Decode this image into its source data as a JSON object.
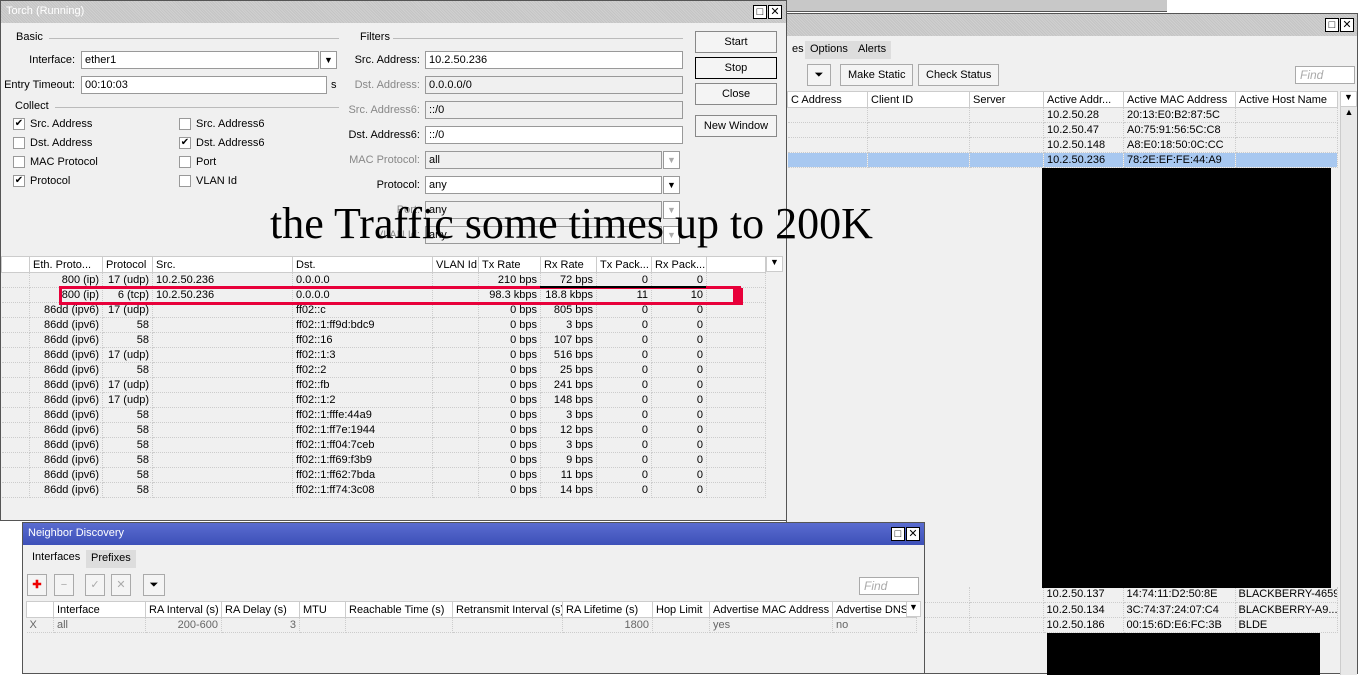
{
  "torch": {
    "title": "Torch (Running)",
    "basic_label": "Basic",
    "interface_label": "Interface:",
    "interface_value": "ether1",
    "entry_timeout_label": "Entry Timeout:",
    "entry_timeout_value": "00:10:03",
    "entry_timeout_unit": "s",
    "collect_label": "Collect",
    "collect": [
      {
        "label": "Src. Address",
        "checked": true
      },
      {
        "label": "Dst. Address",
        "checked": false
      },
      {
        "label": "MAC Protocol",
        "checked": false
      },
      {
        "label": "Protocol",
        "checked": true
      },
      {
        "label": "Src. Address6",
        "checked": false
      },
      {
        "label": "Dst. Address6",
        "checked": true
      },
      {
        "label": "Port",
        "checked": false
      },
      {
        "label": "VLAN Id",
        "checked": false
      }
    ],
    "filters_label": "Filters",
    "filters": [
      {
        "label": "Src. Address:",
        "value": "10.2.50.236",
        "enabled": true
      },
      {
        "label": "Dst. Address:",
        "value": "0.0.0.0/0",
        "enabled": false
      },
      {
        "label": "Src. Address6:",
        "value": "::/0",
        "enabled": false
      },
      {
        "label": "Dst. Address6:",
        "value": "::/0",
        "enabled": true
      },
      {
        "label": "MAC Protocol:",
        "value": "all",
        "enabled": false,
        "dropdown": true
      },
      {
        "label": "Protocol:",
        "value": "any",
        "enabled": true,
        "dropdown": true
      },
      {
        "label": "Port:",
        "value": "any",
        "enabled": false,
        "dropdown": true
      },
      {
        "label": "VLAN Id:",
        "value": "any",
        "enabled": false,
        "dropdown": true
      }
    ],
    "buttons": {
      "start": "Start",
      "stop": "Stop",
      "close": "Close",
      "new_window": "New Window"
    },
    "columns": [
      "",
      "Eth. Proto...",
      "Protocol",
      "Src.",
      "Dst.",
      "VLAN Id",
      "Tx Rate",
      "Rx Rate",
      "Tx Pack...",
      "Rx Pack..."
    ],
    "rows": [
      [
        "800 (ip)",
        "17 (udp)",
        "10.2.50.236",
        "0.0.0.0",
        "",
        "210 bps",
        "72 bps",
        "0",
        "0"
      ],
      [
        "800 (ip)",
        "6 (tcp)",
        "10.2.50.236",
        "0.0.0.0",
        "",
        "98.3 kbps",
        "18.8 kbps",
        "11",
        "10"
      ],
      [
        "86dd (ipv6)",
        "17 (udp)",
        "",
        "ff02::c",
        "",
        "0 bps",
        "805 bps",
        "0",
        "0"
      ],
      [
        "86dd (ipv6)",
        "58",
        "",
        "ff02::1:ff9d:bdc9",
        "",
        "0 bps",
        "3 bps",
        "0",
        "0"
      ],
      [
        "86dd (ipv6)",
        "58",
        "",
        "ff02::16",
        "",
        "0 bps",
        "107 bps",
        "0",
        "0"
      ],
      [
        "86dd (ipv6)",
        "17 (udp)",
        "",
        "ff02::1:3",
        "",
        "0 bps",
        "516 bps",
        "0",
        "0"
      ],
      [
        "86dd (ipv6)",
        "58",
        "",
        "ff02::2",
        "",
        "0 bps",
        "25 bps",
        "0",
        "0"
      ],
      [
        "86dd (ipv6)",
        "17 (udp)",
        "",
        "ff02::fb",
        "",
        "0 bps",
        "241 bps",
        "0",
        "0"
      ],
      [
        "86dd (ipv6)",
        "17 (udp)",
        "",
        "ff02::1:2",
        "",
        "0 bps",
        "148 bps",
        "0",
        "0"
      ],
      [
        "86dd (ipv6)",
        "58",
        "",
        "ff02::1:fffe:44a9",
        "",
        "0 bps",
        "3 bps",
        "0",
        "0"
      ],
      [
        "86dd (ipv6)",
        "58",
        "",
        "ff02::1:ff7e:1944",
        "",
        "0 bps",
        "12 bps",
        "0",
        "0"
      ],
      [
        "86dd (ipv6)",
        "58",
        "",
        "ff02::1:ff04:7ceb",
        "",
        "0 bps",
        "3 bps",
        "0",
        "0"
      ],
      [
        "86dd (ipv6)",
        "58",
        "",
        "ff02::1:ff69:f3b9",
        "",
        "0 bps",
        "9 bps",
        "0",
        "0"
      ],
      [
        "86dd (ipv6)",
        "58",
        "",
        "ff02::1:ff62:7bda",
        "",
        "0 bps",
        "11 bps",
        "0",
        "0"
      ],
      [
        "86dd (ipv6)",
        "58",
        "",
        "ff02::1:ff74:3c08",
        "",
        "0 bps",
        "14 bps",
        "0",
        "0"
      ]
    ],
    "highlight_color": "#e8003a"
  },
  "overlay_text": "the Traffic some times up to 200K",
  "dhcp": {
    "tabs": [
      "es",
      "Options",
      "Alerts"
    ],
    "toolbar": {
      "make_static": "Make Static",
      "check_status": "Check Status",
      "find_placeholder": "Find"
    },
    "columns": [
      "C Address",
      "Client ID",
      "Server",
      "Active Addr...",
      "Active MAC Address",
      "Active Host Name"
    ],
    "rows_top": [
      [
        "",
        "",
        "",
        "10.2.50.28",
        "20:13:E0:B2:87:5C",
        ""
      ],
      [
        "",
        "",
        "",
        "10.2.50.47",
        "A0:75:91:56:5C:C8",
        ""
      ],
      [
        "",
        "",
        "",
        "10.2.50.148",
        "A8:E0:18:50:0C:CC",
        ""
      ],
      [
        "",
        "",
        "",
        "10.2.50.236",
        "78:2E:EF:FE:44:A9",
        ""
      ]
    ],
    "selected_row": 3,
    "rows_bottom": [
      [
        "",
        "",
        "",
        "10.2.50.137",
        "14:74:11:D2:50:8E",
        "BLACKBERRY-4659"
      ],
      [
        "",
        "",
        "",
        "10.2.50.134",
        "3C:74:37:24:07:C4",
        "BLACKBERRY-A9..."
      ],
      [
        "",
        "",
        "",
        "10.2.50.186",
        "00:15:6D:E6:FC:3B",
        "BLDE"
      ]
    ],
    "selection_color": "#a8c8f0"
  },
  "nd": {
    "title": "Neighbor Discovery",
    "tabs": [
      "Interfaces",
      "Prefixes"
    ],
    "find_placeholder": "Find",
    "columns": [
      "",
      "Interface",
      "RA Interval (s)",
      "RA Delay (s)",
      "MTU",
      "Reachable Time (s)",
      "Retransmit Interval (s)",
      "RA Lifetime (s)",
      "Hop Limit",
      "Advertise MAC Address",
      "Advertise DNS"
    ],
    "rows": [
      [
        "X",
        "all",
        "200-600",
        "3",
        "",
        "",
        "",
        "1800",
        "",
        "yes",
        "no"
      ]
    ],
    "title_color": "#4a5cc4"
  }
}
